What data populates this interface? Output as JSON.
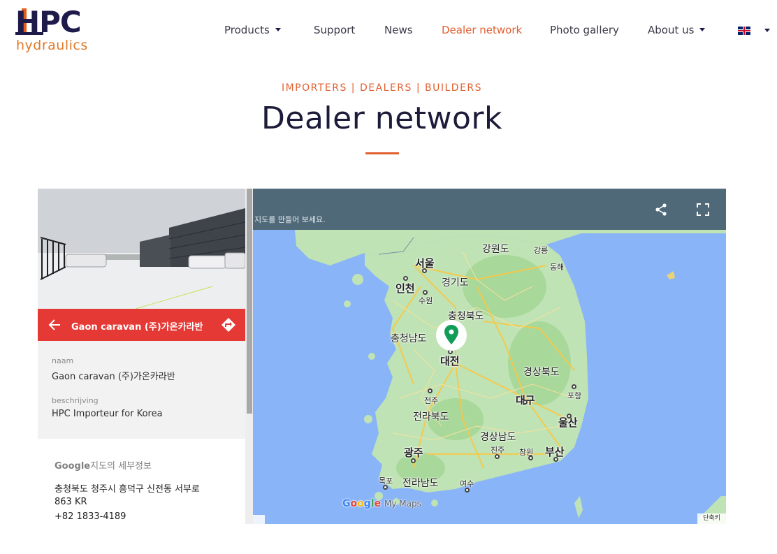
{
  "header": {
    "logo_main": "HPC",
    "logo_sub": "hydraulics",
    "nav": [
      {
        "label": "Products",
        "has_caret": true
      },
      {
        "label": "Support",
        "has_caret": false
      },
      {
        "label": "News",
        "has_caret": false
      },
      {
        "label": "Dealer network",
        "has_caret": false,
        "active": true
      },
      {
        "label": "Photo gallery",
        "has_caret": false
      },
      {
        "label": "About us",
        "has_caret": true
      }
    ],
    "language_flag": "uk-flag-icon"
  },
  "hero": {
    "eyebrow": "IMPORTERS | DEALERS | BUILDERS",
    "title": "Dealer network"
  },
  "place_panel": {
    "name": "Gaon caravan (주)가온카라반",
    "fields": [
      {
        "label": "naam",
        "value": "Gaon caravan (주)가온카라반"
      },
      {
        "label": "beschrijving",
        "value": "HPC Importeur for Korea"
      }
    ],
    "google_details_brand": "Google",
    "google_details_rest": "지도의 세부정보",
    "address_line1": "충청북도 청주시 흥덕구 신전동 서부로",
    "address_line2": "863 KR",
    "phone": "+82 1833-4189"
  },
  "map": {
    "hint": "지도를 만들어 보세요.",
    "shortcut_label": "단축키",
    "logo_my_maps": "My Maps",
    "labels": [
      {
        "text": "강원도"
      },
      {
        "text": "강릉"
      },
      {
        "text": "동해"
      },
      {
        "text": "서울"
      },
      {
        "text": "경기도"
      },
      {
        "text": "인천"
      },
      {
        "text": "수원"
      },
      {
        "text": "충청북도"
      },
      {
        "text": "충청남도"
      },
      {
        "text": "대전"
      },
      {
        "text": "경상북도"
      },
      {
        "text": "포항"
      },
      {
        "text": "전주"
      },
      {
        "text": "대구"
      },
      {
        "text": "전라북도"
      },
      {
        "text": "울산"
      },
      {
        "text": "경상남도"
      },
      {
        "text": "광주"
      },
      {
        "text": "진주"
      },
      {
        "text": "창원"
      },
      {
        "text": "부산"
      },
      {
        "text": "목포"
      },
      {
        "text": "전라남도"
      },
      {
        "text": "여수"
      }
    ]
  },
  "colors": {
    "accent": "#e06030",
    "brand_navy": "#1e1b4b",
    "place_bar": "#e53935",
    "map_header": "#4f6978",
    "map_water": "#8ab4f8",
    "map_land": "#bfe3b4"
  }
}
